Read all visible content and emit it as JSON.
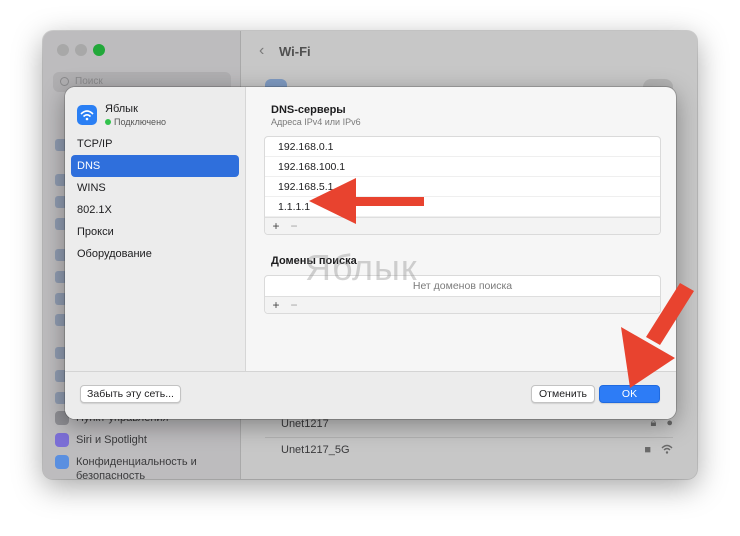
{
  "window": {
    "title": "Wi-Fi",
    "search_placeholder": "Поиск",
    "sidebar_items": [
      {
        "label": "Пункт управления"
      },
      {
        "label": "Siri и Spotlight"
      },
      {
        "label": "Конфиденциальность и безопасность"
      }
    ],
    "networks": [
      {
        "name": "Unet1217"
      },
      {
        "name": "Unet1217_5G"
      }
    ]
  },
  "sheet": {
    "interface": {
      "name": "Яблык",
      "status": "Подключено"
    },
    "tabs": [
      {
        "label": "TCP/IP"
      },
      {
        "label": "DNS"
      },
      {
        "label": "WINS"
      },
      {
        "label": "802.1X"
      },
      {
        "label": "Прокси"
      },
      {
        "label": "Оборудование"
      }
    ],
    "active_tab": "DNS",
    "dns": {
      "title": "DNS-серверы",
      "subtitle": "Адреса IPv4 или IPv6",
      "servers": [
        "192.168.0.1",
        "192.168.100.1",
        "192.168.5.1",
        "1.1.1.1"
      ]
    },
    "search_domains": {
      "title": "Домены поиска",
      "empty_text": "Нет доменов поиска"
    },
    "add_symbol": "+",
    "remove_symbol": "−",
    "buttons": {
      "forget": "Забыть эту сеть...",
      "cancel": "Отменить",
      "ok": "OK"
    }
  },
  "watermark": "Яблык",
  "colors": {
    "accent": "#2d7cf6",
    "arrow": "#e8432f",
    "connected": "#32c24c"
  }
}
